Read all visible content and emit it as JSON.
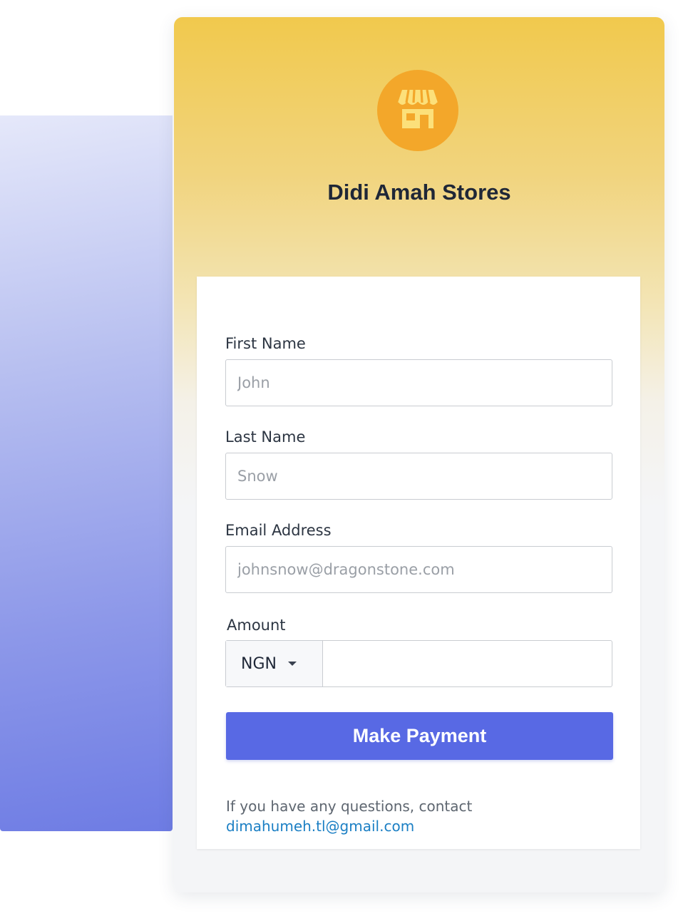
{
  "store": {
    "name": "Didi Amah Stores",
    "logo_icon": "storefront-icon"
  },
  "form": {
    "first_name": {
      "label": "First Name",
      "placeholder": "John",
      "value": ""
    },
    "last_name": {
      "label": "Last Name",
      "placeholder": "Snow",
      "value": ""
    },
    "email": {
      "label": "Email Address",
      "placeholder": "johnsnow@dragonstone.com",
      "value": ""
    },
    "amount": {
      "label": "Amount",
      "currency": "NGN",
      "value": ""
    },
    "submit_label": "Make Payment"
  },
  "footer": {
    "help_text": "If you have any questions, contact",
    "contact_email": "dimahumeh.tl@gmail.com"
  },
  "colors": {
    "accent": "#5869e4",
    "logo_bg": "#f3a72a",
    "header_gradient_top": "#f1c94d",
    "link": "#1b7fc4"
  }
}
